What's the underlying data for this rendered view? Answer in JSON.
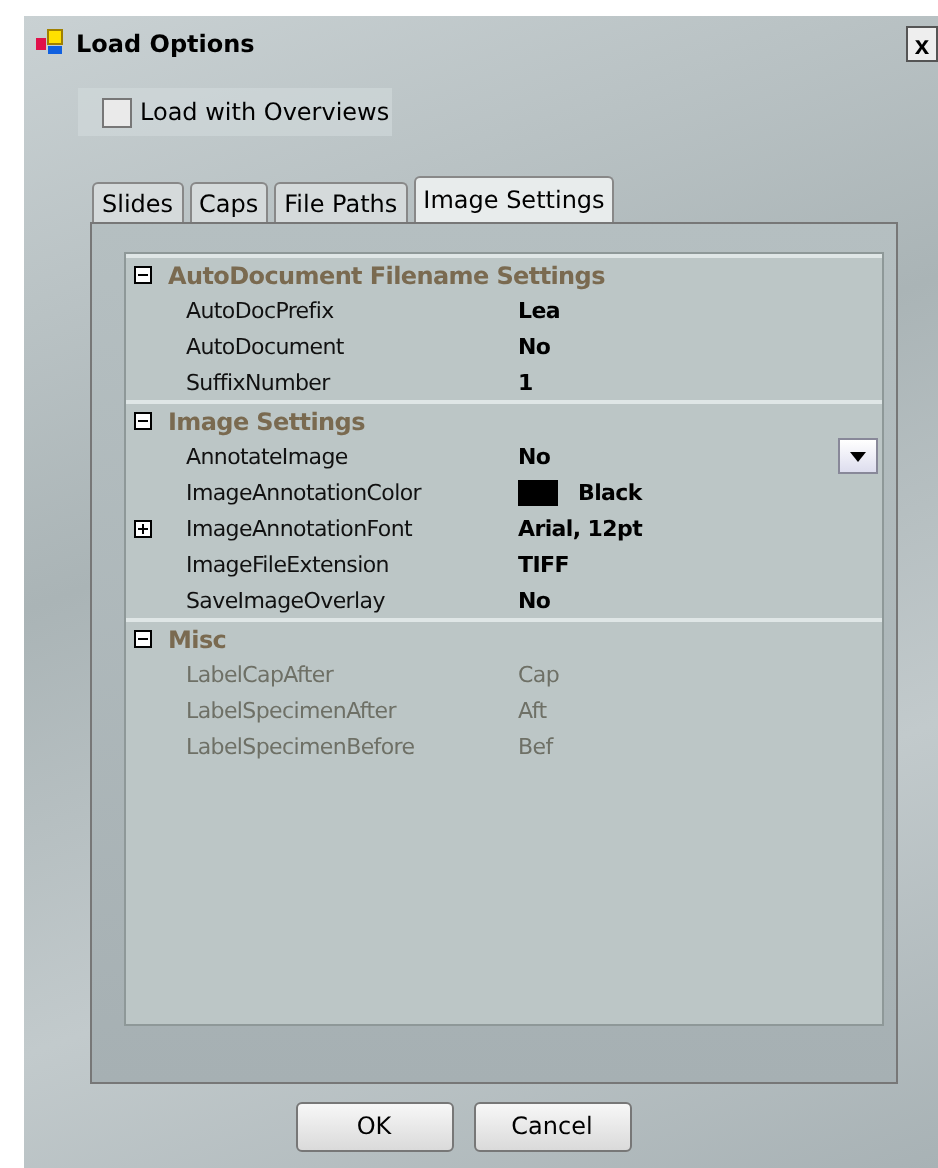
{
  "window": {
    "title": "Load Options",
    "close": "x"
  },
  "load_with_overviews": {
    "label": "Load with Overviews",
    "checked": false
  },
  "tabs": [
    {
      "label": "Slides",
      "selected": false
    },
    {
      "label": "Caps",
      "selected": false
    },
    {
      "label": "File Paths",
      "selected": false
    },
    {
      "label": "Image Settings",
      "selected": true
    }
  ],
  "categories": [
    {
      "name": "AutoDocument Filename Settings",
      "expanded": true,
      "properties": [
        {
          "name": "AutoDocPrefix",
          "value": "Lea",
          "kind": "text",
          "disabled": false,
          "selected": false
        },
        {
          "name": "AutoDocument",
          "value": "No",
          "kind": "text",
          "disabled": false,
          "selected": false
        },
        {
          "name": "SuffixNumber",
          "value": "1",
          "kind": "text",
          "disabled": false,
          "selected": false
        }
      ]
    },
    {
      "name": "Image Settings",
      "expanded": true,
      "properties": [
        {
          "name": "AnnotateImage",
          "value": "No",
          "kind": "text",
          "disabled": false,
          "selected": true
        },
        {
          "name": "ImageAnnotationColor",
          "value": "Black",
          "kind": "color",
          "color": "#000000",
          "disabled": false,
          "selected": false
        },
        {
          "name": "ImageAnnotationFont",
          "value": "Arial, 12pt",
          "kind": "expandable",
          "expanded": false,
          "disabled": false,
          "selected": false
        },
        {
          "name": "ImageFileExtension",
          "value": "TIFF",
          "kind": "text",
          "disabled": false,
          "selected": false
        },
        {
          "name": "SaveImageOverlay",
          "value": "No",
          "kind": "text",
          "disabled": false,
          "selected": false
        }
      ]
    },
    {
      "name": "Misc",
      "expanded": true,
      "properties": [
        {
          "name": "LabelCapAfter",
          "value": "Cap",
          "kind": "text",
          "disabled": true,
          "selected": false
        },
        {
          "name": "LabelSpecimenAfter",
          "value": "Aft",
          "kind": "text",
          "disabled": true,
          "selected": false
        },
        {
          "name": "LabelSpecimenBefore",
          "value": "Bef",
          "kind": "text",
          "disabled": true,
          "selected": false
        }
      ]
    }
  ],
  "buttons": [
    "OK",
    "Cancel"
  ]
}
